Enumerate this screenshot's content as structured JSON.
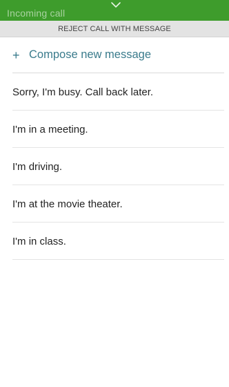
{
  "status": {
    "underlying_text": "Incoming call"
  },
  "panel": {
    "header": "REJECT CALL WITH MESSAGE",
    "compose_label": "Compose new message",
    "compose_icon": "plus-icon"
  },
  "messages": [
    "Sorry, I'm busy. Call back later.",
    "I'm in a meeting.",
    "I'm driving.",
    "I'm at the movie theater.",
    "I'm in class."
  ],
  "colors": {
    "status_bar": "#3e9c2c",
    "header_bg": "#e3e3e3",
    "accent": "#3a7b8c"
  }
}
